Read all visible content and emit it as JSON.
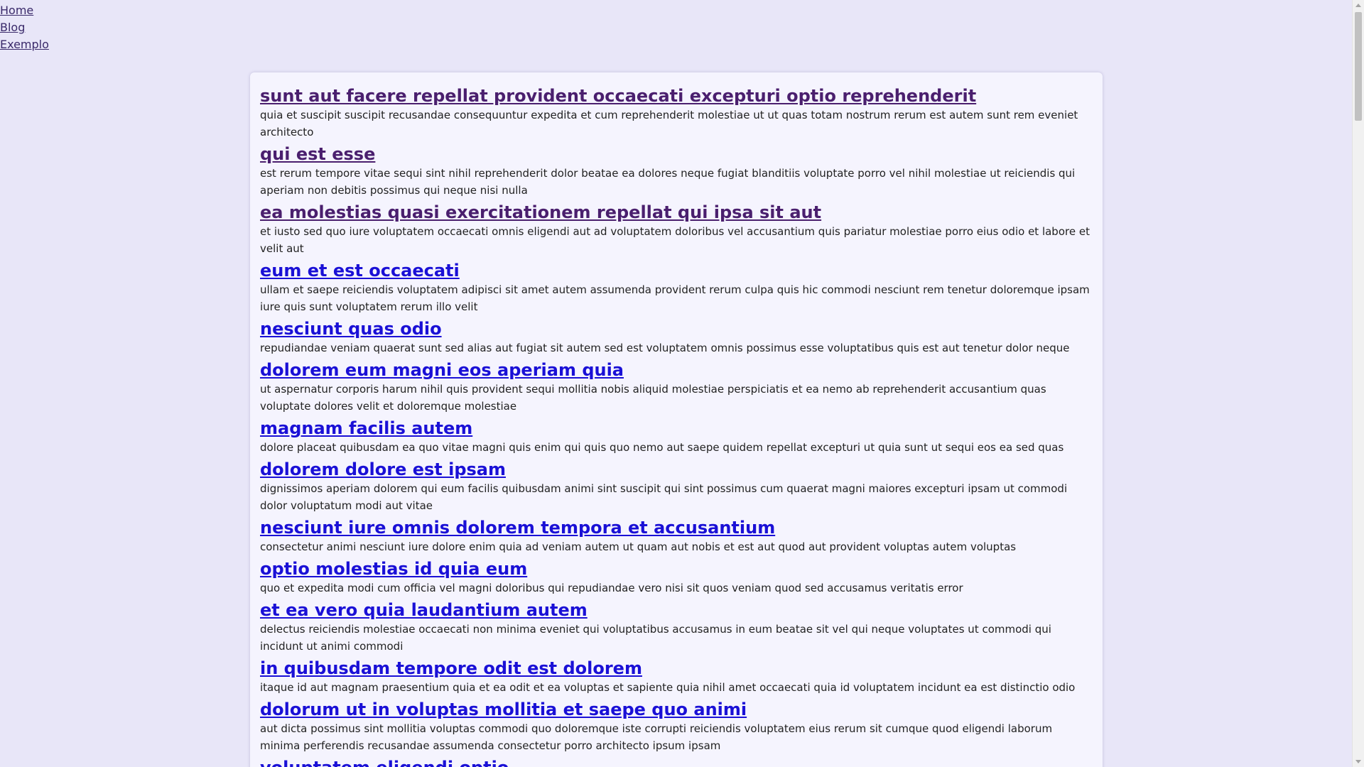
{
  "nav": {
    "links": [
      "Home",
      "Blog",
      "Exemplo"
    ]
  },
  "posts": [
    {
      "title": "sunt aut facere repellat provident occaecati excepturi optio reprehenderit",
      "body": "quia et suscipit suscipit recusandae consequuntur expedita et cum reprehenderit molestiae ut ut quas totam nostrum rerum est autem sunt rem eveniet architecto",
      "visited": true
    },
    {
      "title": "qui est esse",
      "body": "est rerum tempore vitae sequi sint nihil reprehenderit dolor beatae ea dolores neque fugiat blanditiis voluptate porro vel nihil molestiae ut reiciendis qui aperiam non debitis possimus qui neque nisi nulla",
      "visited": true
    },
    {
      "title": "ea molestias quasi exercitationem repellat qui ipsa sit aut",
      "body": "et iusto sed quo iure voluptatem occaecati omnis eligendi aut ad voluptatem doloribus vel accusantium quis pariatur molestiae porro eius odio et labore et velit aut",
      "visited": true
    },
    {
      "title": "eum et est occaecati",
      "body": "ullam et saepe reiciendis voluptatem adipisci sit amet autem assumenda provident rerum culpa quis hic commodi nesciunt rem tenetur doloremque ipsam iure quis sunt voluptatem rerum illo velit",
      "visited": false
    },
    {
      "title": "nesciunt quas odio",
      "body": "repudiandae veniam quaerat sunt sed alias aut fugiat sit autem sed est voluptatem omnis possimus esse voluptatibus quis est aut tenetur dolor neque",
      "visited": false
    },
    {
      "title": "dolorem eum magni eos aperiam quia",
      "body": "ut aspernatur corporis harum nihil quis provident sequi mollitia nobis aliquid molestiae perspiciatis et ea nemo ab reprehenderit accusantium quas voluptate dolores velit et doloremque molestiae",
      "visited": false
    },
    {
      "title": "magnam facilis autem",
      "body": "dolore placeat quibusdam ea quo vitae magni quis enim qui quis quo nemo aut saepe quidem repellat excepturi ut quia sunt ut sequi eos ea sed quas",
      "visited": false
    },
    {
      "title": "dolorem dolore est ipsam",
      "body": "dignissimos aperiam dolorem qui eum facilis quibusdam animi sint suscipit qui sint possimus cum quaerat magni maiores excepturi ipsam ut commodi dolor voluptatum modi aut vitae",
      "visited": false
    },
    {
      "title": "nesciunt iure omnis dolorem tempora et accusantium",
      "body": "consectetur animi nesciunt iure dolore enim quia ad veniam autem ut quam aut nobis et est aut quod aut provident voluptas autem voluptas",
      "visited": false
    },
    {
      "title": "optio molestias id quia eum",
      "body": "quo et expedita modi cum officia vel magni doloribus qui repudiandae vero nisi sit quos veniam quod sed accusamus veritatis error",
      "visited": false
    },
    {
      "title": "et ea vero quia laudantium autem",
      "body": "delectus reiciendis molestiae occaecati non minima eveniet qui voluptatibus accusamus in eum beatae sit vel qui neque voluptates ut commodi qui incidunt ut animi commodi",
      "visited": false
    },
    {
      "title": "in quibusdam tempore odit est dolorem",
      "body": "itaque id aut magnam praesentium quia et ea odit et ea voluptas et sapiente quia nihil amet occaecati quia id voluptatem incidunt ea est distinctio odio",
      "visited": false
    },
    {
      "title": "dolorum ut in voluptas mollitia et saepe quo animi",
      "body": "aut dicta possimus sint mollitia voluptas commodi quo doloremque iste corrupti reiciendis voluptatem eius rerum sit cumque quod eligendi laborum minima perferendis recusandae assumenda consectetur porro architecto ipsum ipsam",
      "visited": false
    },
    {
      "title": "voluptatem eligendi optio",
      "body": "",
      "visited": false
    }
  ]
}
